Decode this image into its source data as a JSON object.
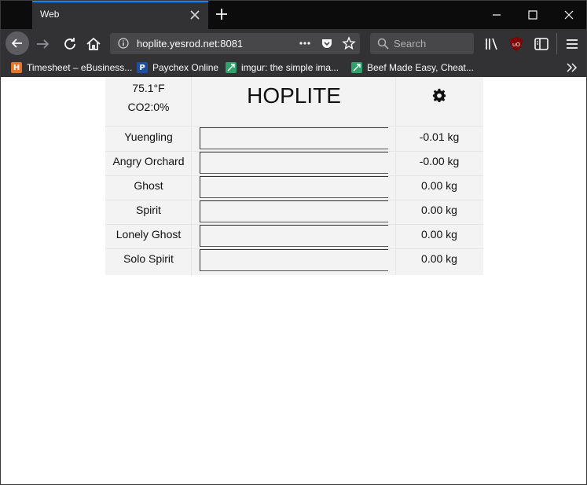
{
  "browser": {
    "tab_title": "Web",
    "url": "hoplite.yesrod.net:8081",
    "search_placeholder": "Search",
    "bookmarks": [
      {
        "label": "Timesheet – eBusiness...",
        "icon": "H",
        "color": "#e8742a"
      },
      {
        "label": "Paychex Online",
        "icon": "P",
        "color": "#1d4fa0"
      },
      {
        "label": "imgur: the simple ima...",
        "icon": "",
        "color": "#2fa36b"
      },
      {
        "label": "Beef Made Easy, Cheat...",
        "icon": "",
        "color": "#2fa36b"
      }
    ]
  },
  "header": {
    "temperature": "75.1°F",
    "co2": "CO2:0%",
    "title": "HOPLITE"
  },
  "kegs": [
    {
      "name": "Yuengling",
      "weight": "-0.01 kg",
      "level": 0
    },
    {
      "name": "Angry Orchard",
      "weight": "-0.00 kg",
      "level": 0
    },
    {
      "name": "Ghost",
      "weight": "0.00 kg",
      "level": 0
    },
    {
      "name": "Spirit",
      "weight": "0.00 kg",
      "level": 0
    },
    {
      "name": "Lonely Ghost",
      "weight": "0.00 kg",
      "level": 0
    },
    {
      "name": "Solo Spirit",
      "weight": "0.00 kg",
      "level": 0
    }
  ]
}
